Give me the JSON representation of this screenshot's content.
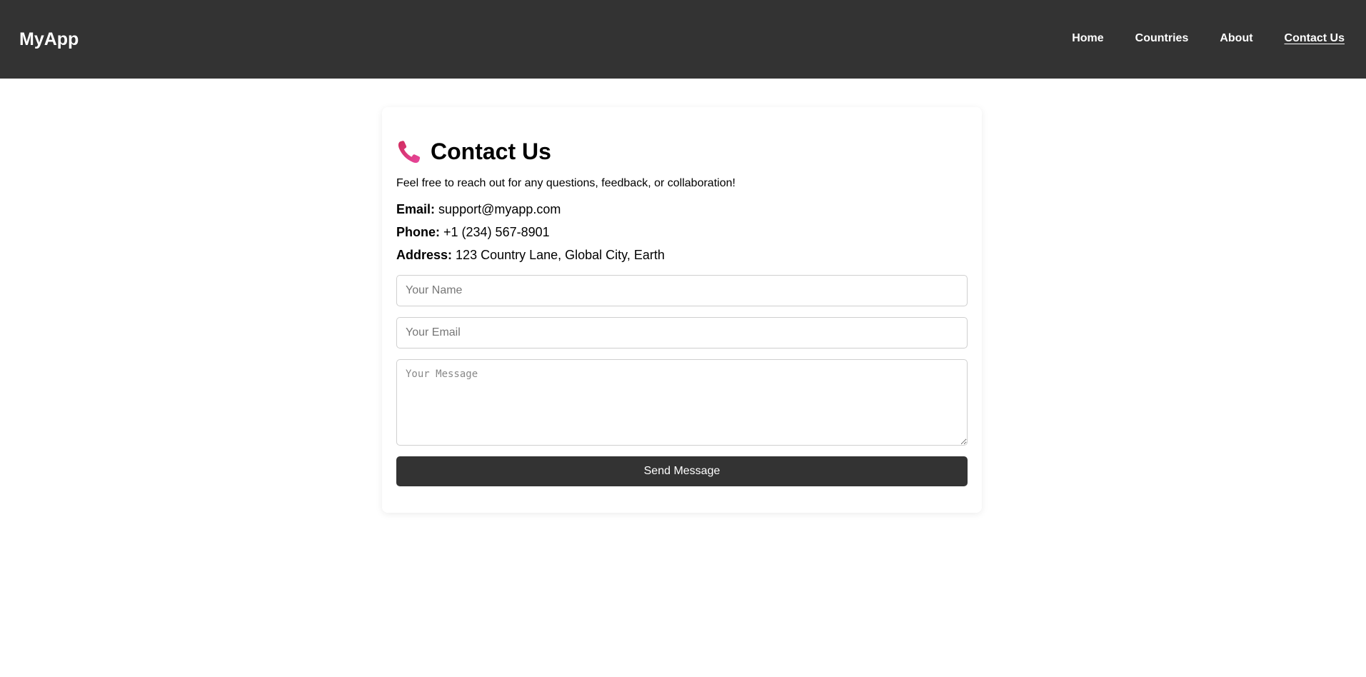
{
  "navbar": {
    "brand": "MyApp",
    "links": [
      {
        "label": "Home",
        "active": false
      },
      {
        "label": "Countries",
        "active": false
      },
      {
        "label": "About",
        "active": false
      },
      {
        "label": "Contact Us",
        "active": true
      }
    ]
  },
  "contact": {
    "icon": "telephone-receiver-icon",
    "icon_color": "#e0357a",
    "title": "Contact Us",
    "intro": "Feel free to reach out for any questions, feedback, or collaboration!",
    "email_label": "Email:",
    "email_value": "support@myapp.com",
    "phone_label": "Phone:",
    "phone_value": "+1 (234) 567-8901",
    "address_label": "Address:",
    "address_value": "123 Country Lane, Global City, Earth"
  },
  "form": {
    "name_placeholder": "Your Name",
    "email_placeholder": "Your Email",
    "message_placeholder": "Your Message",
    "submit_label": "Send Message"
  },
  "colors": {
    "navbar_bg": "#333333",
    "button_bg": "#333333",
    "accent_icon": "#e0357a"
  }
}
